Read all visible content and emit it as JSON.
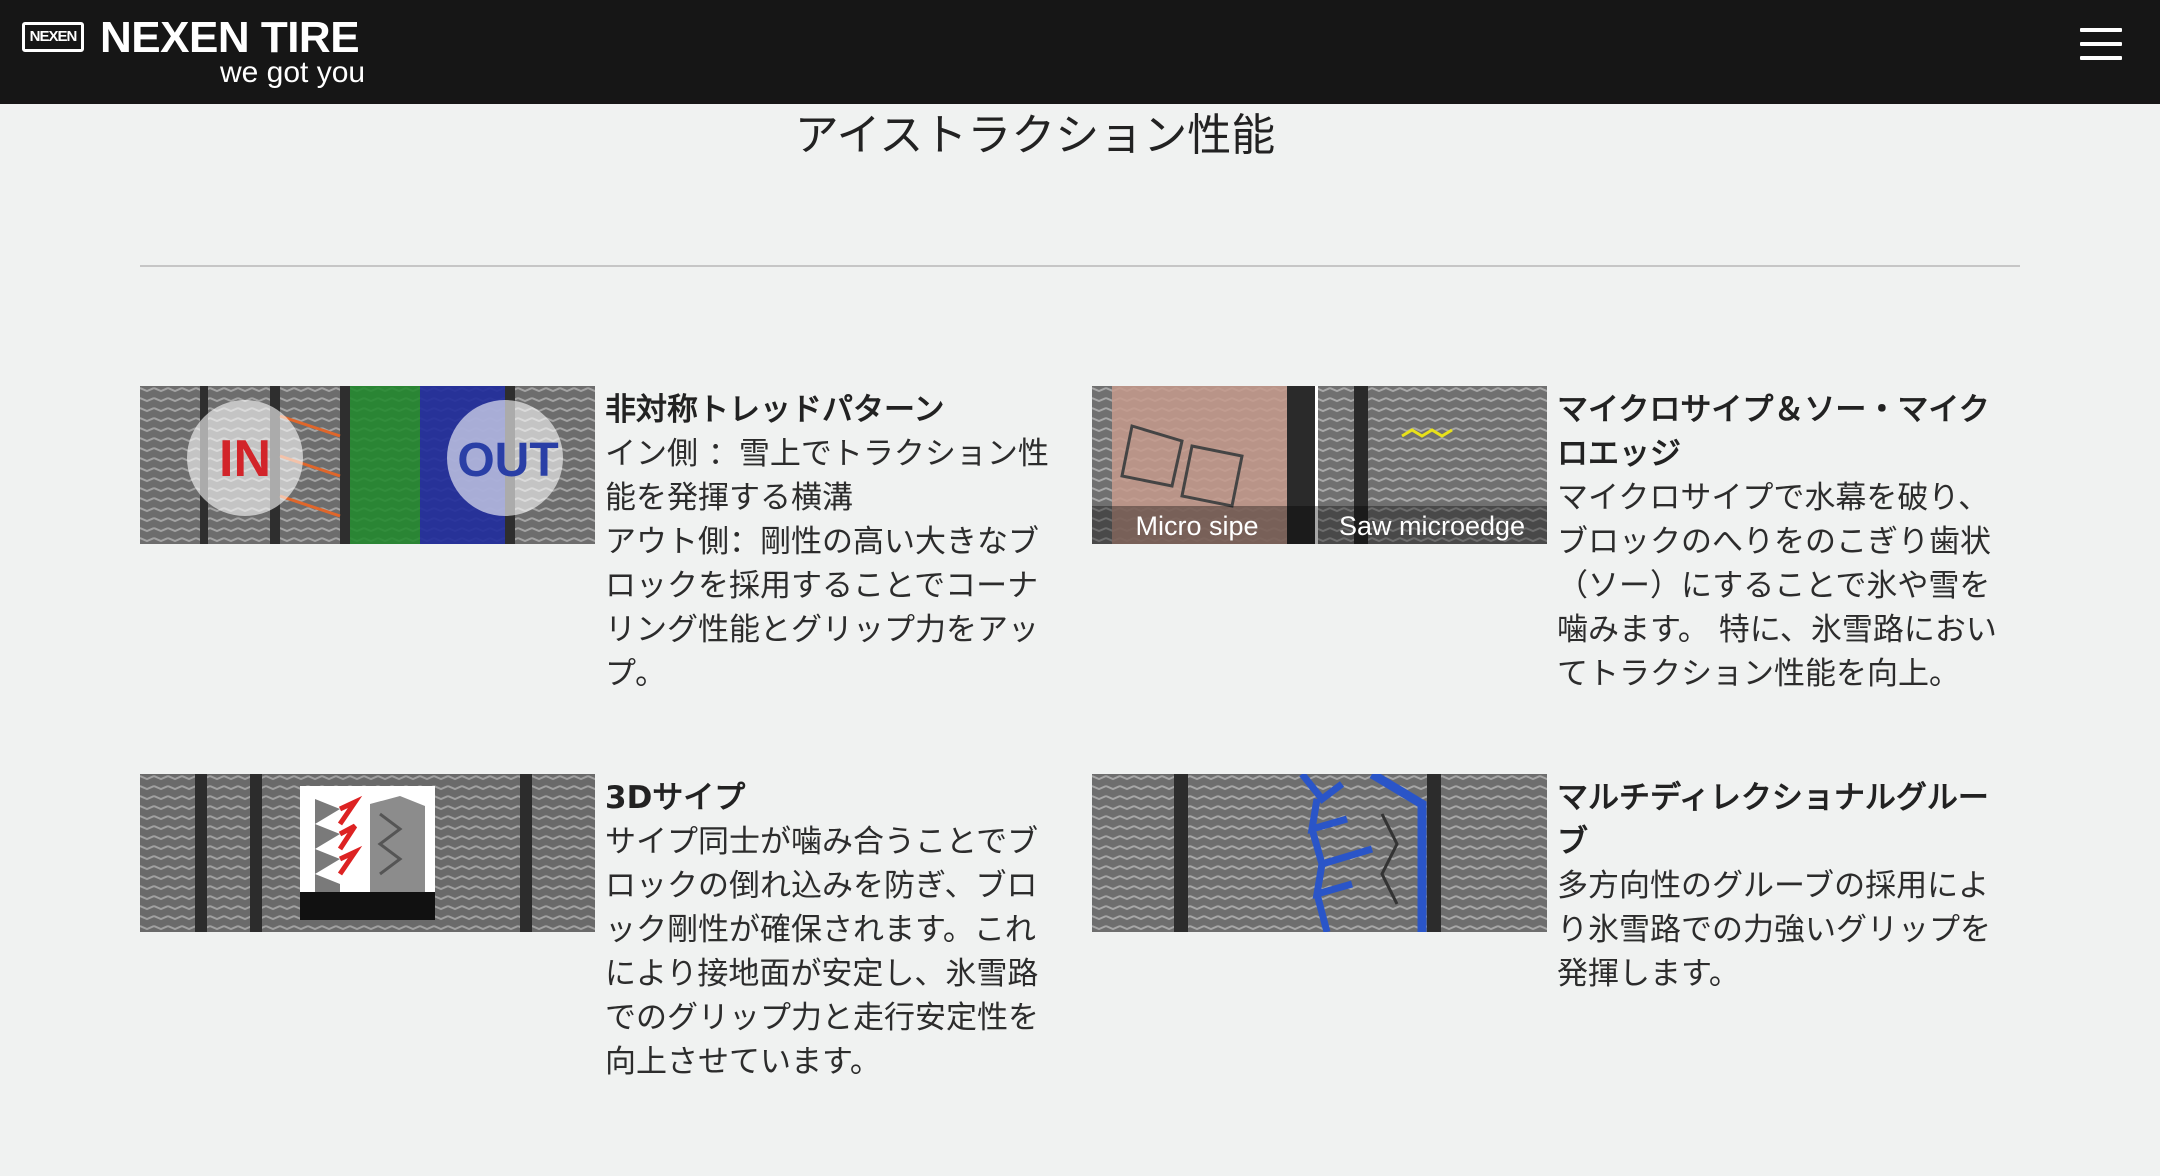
{
  "header": {
    "logo_mark": "NEXEN",
    "logo_name": "NEXEN TIRE",
    "tagline": "we got you"
  },
  "page": {
    "title": "アイストラクション性能"
  },
  "features": [
    {
      "title": "非対称トレッドパターン",
      "description": "イン側 ：雪上でトラクション性能を発揮する横溝\nアウト側：剛性の高い大きなブロックを採用することでコーナリング性能とグリップ力をアップ。",
      "image_labels": [
        "IN",
        "OUT"
      ]
    },
    {
      "title": "マイクロサイプ＆ソー・マイクロエッジ",
      "description": "マイクロサイプで水幕を破り、ブロックのへりをのこぎり歯状（ソー）にすることで氷や雪を噛みます。 特に、氷雪路においてトラクション性能を向上。",
      "image_labels": [
        "Micro sipe",
        "Saw microedge"
      ]
    },
    {
      "title": "3Dサイプ",
      "description": "サイプ同士が噛み合うことでブロックの倒れ込みを防ぎ、ブロック剛性が確保されます。これにより接地面が安定し、氷雪路でのグリップ力と走行安定性を向上させています。",
      "image_labels": []
    },
    {
      "title": "マルチディレクショナルグルーブ",
      "description": "多方向性のグルーブの採用により氷雪路での力強いグリップを発揮します。",
      "image_labels": []
    }
  ]
}
